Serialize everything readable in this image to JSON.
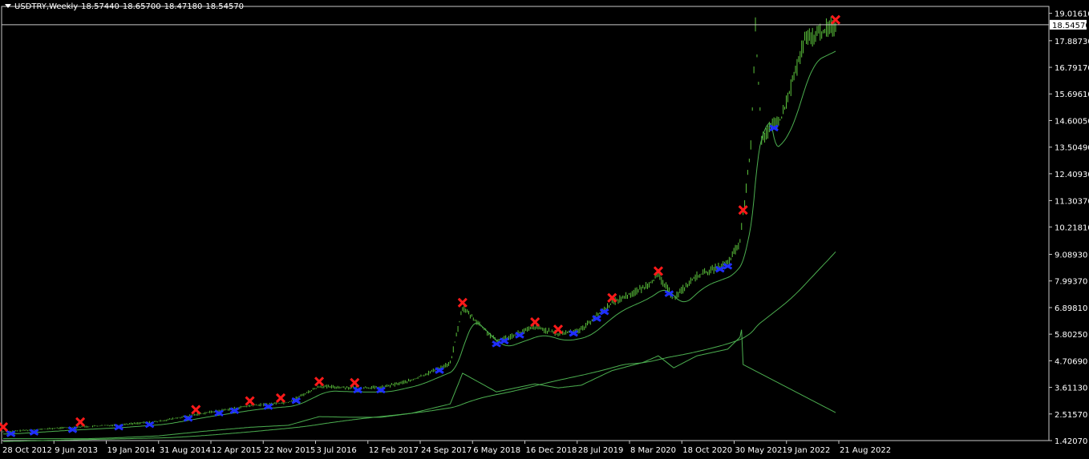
{
  "header": {
    "symbol": "USDTRY,Weekly",
    "open": "18.57440",
    "high": "18.65700",
    "low": "18.47180",
    "close": "18.54570"
  },
  "chart_data": {
    "type": "bar",
    "title": "USDTRY,Weekly",
    "current_price_label": "18.54570",
    "current_price": 18.5457,
    "ylim": [
      1.4202,
      19.3
    ],
    "y_ticks": [
      "19.01610",
      "17.88730",
      "16.79170",
      "15.69610",
      "14.60050",
      "13.50490",
      "12.40930",
      "11.30370",
      "10.21810",
      "9.08930",
      "7.99370",
      "6.89810",
      "5.80250",
      "4.70690",
      "3.61130",
      "2.51570",
      "1.42070"
    ],
    "x_ticks": [
      "28 Oct 2012",
      "9 Jun 2013",
      "19 Jan 2014",
      "31 Aug 2014",
      "12 Apr 2015",
      "22 Nov 2015",
      "3 Jul 2016",
      "12 Feb 2017",
      "24 Sep 2017",
      "6 May 2018",
      "16 Dec 2018",
      "28 Jul 2019",
      "8 Mar 2020",
      "18 Oct 2020",
      "30 May 2021",
      "9 Jan 2022",
      "21 Aug 2022"
    ],
    "series": [
      {
        "type": "ohlc",
        "x": [
          0,
          1,
          2,
          3,
          4,
          5,
          6,
          7,
          8,
          9,
          10,
          11,
          12,
          13,
          14,
          15,
          16,
          17,
          18,
          19,
          20,
          21,
          22,
          23,
          24,
          25,
          26,
          27,
          28,
          29,
          30,
          31,
          32,
          33,
          34,
          35,
          36,
          37,
          38,
          39,
          40,
          41,
          42,
          43,
          44,
          45,
          46,
          47,
          48,
          49,
          50,
          51,
          52,
          53,
          54,
          55,
          56,
          57,
          58,
          59,
          60,
          61,
          62,
          63,
          64,
          65,
          66,
          67,
          68,
          69,
          70,
          71,
          72,
          73,
          74,
          75,
          76,
          77,
          78,
          79,
          80,
          81,
          82,
          83,
          84,
          85,
          86,
          87,
          88,
          89,
          90,
          91,
          92,
          93,
          94,
          95,
          96,
          97,
          98,
          99,
          100,
          101,
          102,
          103,
          104,
          105,
          106,
          107,
          108,
          109,
          110,
          111,
          112,
          113,
          114,
          115,
          116,
          117,
          118,
          119,
          120,
          121,
          122,
          123,
          124,
          125,
          126,
          127,
          128,
          129,
          130,
          131,
          132,
          133,
          134,
          135,
          136,
          137,
          138,
          139,
          140,
          141,
          142,
          143,
          144,
          145,
          146,
          147,
          148,
          149,
          150,
          151,
          152,
          153,
          154,
          155,
          156,
          157,
          158,
          159,
          160,
          161,
          162,
          163,
          164,
          165,
          166,
          167,
          168,
          169,
          170,
          171,
          172,
          173,
          174,
          175,
          176,
          177,
          178,
          179,
          180,
          181,
          182,
          183,
          184,
          185,
          186,
          187,
          188,
          189,
          190,
          191,
          192,
          193,
          194,
          195,
          196,
          197,
          198,
          199,
          200,
          201,
          202,
          203,
          204,
          205,
          206,
          207,
          208,
          209,
          210,
          211,
          212,
          213,
          214,
          215,
          216,
          217,
          218,
          219,
          220,
          221,
          222,
          223,
          224,
          225,
          226,
          227,
          228,
          229,
          230,
          231,
          232,
          233,
          234,
          235,
          236,
          237,
          238,
          239,
          240,
          241,
          242,
          243,
          244,
          245,
          246,
          247,
          248,
          249,
          250,
          251,
          252,
          253,
          254,
          255,
          256,
          257,
          258,
          259,
          260,
          261,
          262,
          263,
          264,
          265,
          266,
          267,
          268,
          269,
          270,
          271,
          272,
          273,
          274,
          275,
          276,
          277,
          278,
          279,
          280,
          281,
          282,
          283,
          284,
          285,
          286,
          287,
          288,
          289,
          290,
          291,
          292,
          293,
          294,
          295,
          296,
          297,
          298,
          299,
          300,
          301,
          302,
          303,
          304,
          305,
          306,
          307,
          308,
          309,
          310,
          311,
          312,
          313,
          314,
          315,
          316,
          317,
          318,
          319,
          320,
          321,
          322,
          323,
          324,
          325,
          326,
          327,
          328,
          329,
          330,
          331,
          332,
          333,
          334,
          335,
          336,
          337,
          338,
          339,
          340,
          341,
          342,
          343,
          344,
          345,
          346,
          347,
          348,
          349,
          350,
          351,
          352,
          353,
          354,
          355,
          356,
          357,
          358,
          359,
          360,
          361,
          362,
          363,
          364,
          365,
          366,
          367,
          368,
          369,
          370,
          371,
          372,
          373,
          374,
          375,
          376,
          377,
          378,
          379,
          380,
          381,
          382,
          383,
          384,
          385,
          386,
          387,
          388,
          389,
          390,
          391,
          392,
          393,
          394,
          395,
          396,
          397,
          398,
          399,
          400,
          401,
          402,
          403,
          404,
          405,
          406,
          407,
          408,
          409,
          410,
          411,
          412,
          413,
          414,
          415,
          416,
          417,
          418,
          419,
          420,
          421,
          422,
          423,
          424,
          425,
          426,
          427,
          428,
          429,
          430,
          431,
          432,
          433,
          434,
          435,
          436,
          437,
          438,
          439,
          440,
          441,
          442,
          443,
          444,
          445,
          446,
          447,
          448,
          449,
          450,
          451,
          452,
          453,
          454,
          455,
          456,
          457,
          458,
          459,
          460,
          461,
          462,
          463,
          464,
          465,
          466,
          467,
          468,
          469,
          470,
          471,
          472,
          473,
          474,
          475,
          476,
          477,
          478,
          479,
          480,
          481,
          482,
          483,
          484,
          485,
          486,
          487,
          488,
          489,
          490,
          491,
          492,
          493,
          494,
          495,
          496,
          497,
          498,
          499,
          500,
          501,
          502,
          503,
          504,
          505,
          506,
          507,
          508,
          509,
          510,
          511,
          512,
          513,
          514,
          515,
          516,
          517,
          518,
          519,
          520,
          521,
          522,
          523,
          524,
          525,
          526,
          527,
          528,
          529,
          530,
          531,
          532,
          533,
          534,
          535,
          536,
          537,
          538,
          539,
          540
        ],
        "close": [],
        "color": "#5cc43c"
      }
    ],
    "indicator_lines_color": "#4caf50",
    "markers": {
      "sell_color": "#ff1a1a",
      "buy_color": "#1f2fff"
    },
    "grid": false,
    "legend": "none"
  }
}
